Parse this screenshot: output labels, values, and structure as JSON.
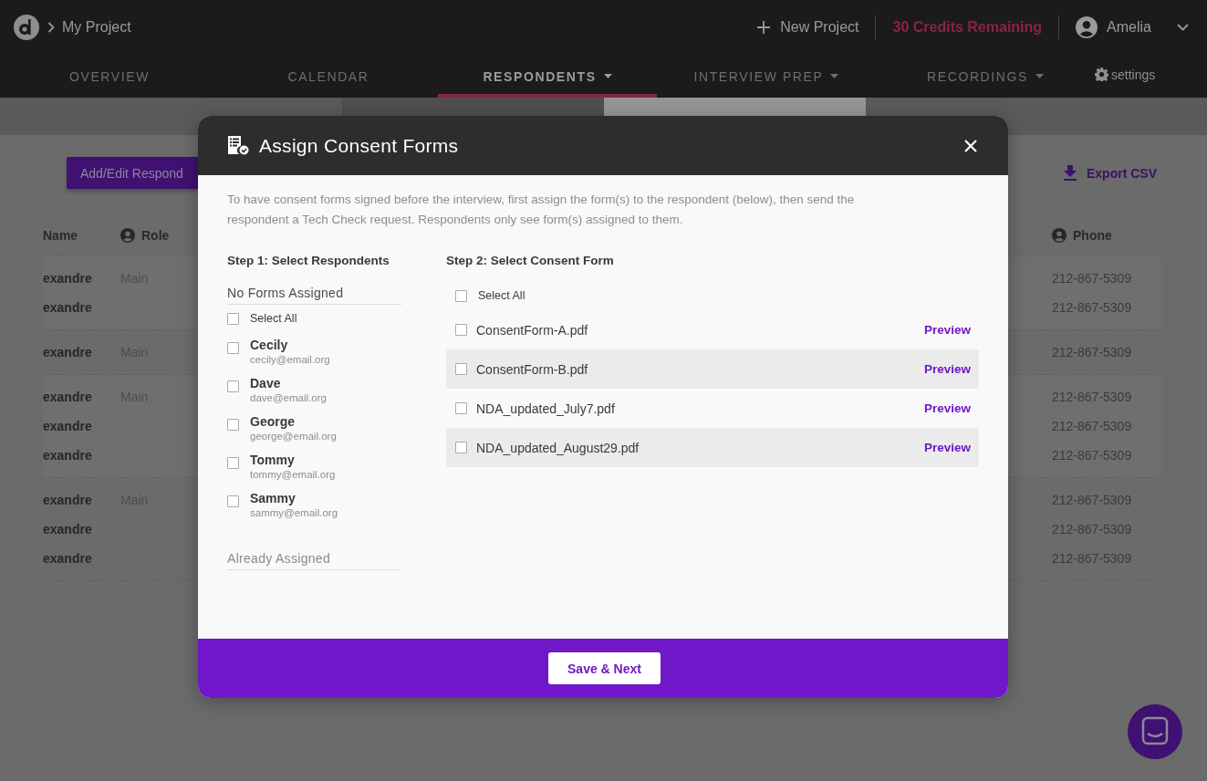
{
  "header": {
    "project": "My Project",
    "new_project": "New Project",
    "credits": "30 Credits Remaining",
    "user": "Amelia"
  },
  "nav": [
    {
      "label": "OVERVIEW",
      "selected": false,
      "dropdown": false
    },
    {
      "label": "CALENDAR",
      "selected": false,
      "dropdown": false
    },
    {
      "label": "RESPONDENTS",
      "selected": true,
      "dropdown": true
    },
    {
      "label": "INTERVIEW PREP",
      "selected": false,
      "dropdown": true
    },
    {
      "label": "RECORDINGS",
      "selected": false,
      "dropdown": true
    }
  ],
  "settings": "settings",
  "subtabs": [
    {
      "selected": false
    },
    {
      "selected": true
    }
  ],
  "page": {
    "add_button": "Add/Edit Respond",
    "export": "Export CSV",
    "columns": [
      {
        "label": "Name",
        "icon": false
      },
      {
        "label": "Role",
        "icon": true
      },
      {
        "label": "Phone",
        "icon": true
      }
    ],
    "groups": [
      [
        {
          "name": "exandre",
          "role": "Main",
          "phone": "212-867-5309"
        },
        {
          "name": "exandre",
          "phone": "212-867-5309"
        }
      ],
      [
        {
          "name": "exandre",
          "role": "Main",
          "phone": "212-867-5309"
        }
      ],
      [
        {
          "name": "exandre",
          "role": "Main",
          "phone": "212-867-5309"
        },
        {
          "name": "exandre",
          "phone": "212-867-5309"
        },
        {
          "name": "exandre",
          "phone": "212-867-5309"
        }
      ],
      [
        {
          "name": "exandre",
          "role": "Main",
          "phone": "212-867-5309"
        },
        {
          "name": "exandre",
          "phone": "212-867-5309"
        },
        {
          "name": "exandre",
          "phone": "212-867-5309"
        }
      ]
    ]
  },
  "modal": {
    "title": "Assign Consent Forms",
    "description": "To have consent forms signed before the interview, first assign the form(s) to the respondent (below), then send the respondent a Tech Check request. Respondents only see form(s) assigned to them.",
    "step1": "Step 1: Select Respondents",
    "no_forms_heading": "No Forms Assigned",
    "respondents_select_all": {
      "label": "Select All",
      "checked": false
    },
    "respondents": [
      {
        "name": "Cecily",
        "email": "cecily@email.org",
        "checked": false
      },
      {
        "name": "Dave",
        "email": "dave@email.org",
        "checked": false
      },
      {
        "name": "George",
        "email": "george@email.org",
        "checked": false
      },
      {
        "name": "Tommy",
        "email": "tommy@email.org",
        "checked": false
      },
      {
        "name": "Sammy",
        "email": "sammy@email.org",
        "checked": false
      }
    ],
    "assigned_heading": "Already Assigned",
    "step2": "Step 2: Select Consent Form",
    "forms_select_all": {
      "label": "Select All",
      "checked": false
    },
    "forms": [
      {
        "name": "ConsentForm-A.pdf",
        "preview": "Preview",
        "checked": false
      },
      {
        "name": "ConsentForm-B.pdf",
        "preview": "Preview",
        "checked": false
      },
      {
        "name": "NDA_updated_July7.pdf",
        "preview": "Preview",
        "checked": false
      },
      {
        "name": "NDA_updated_August29.pdf",
        "preview": "Preview",
        "checked": false
      }
    ],
    "save_button": "Save & Next"
  }
}
